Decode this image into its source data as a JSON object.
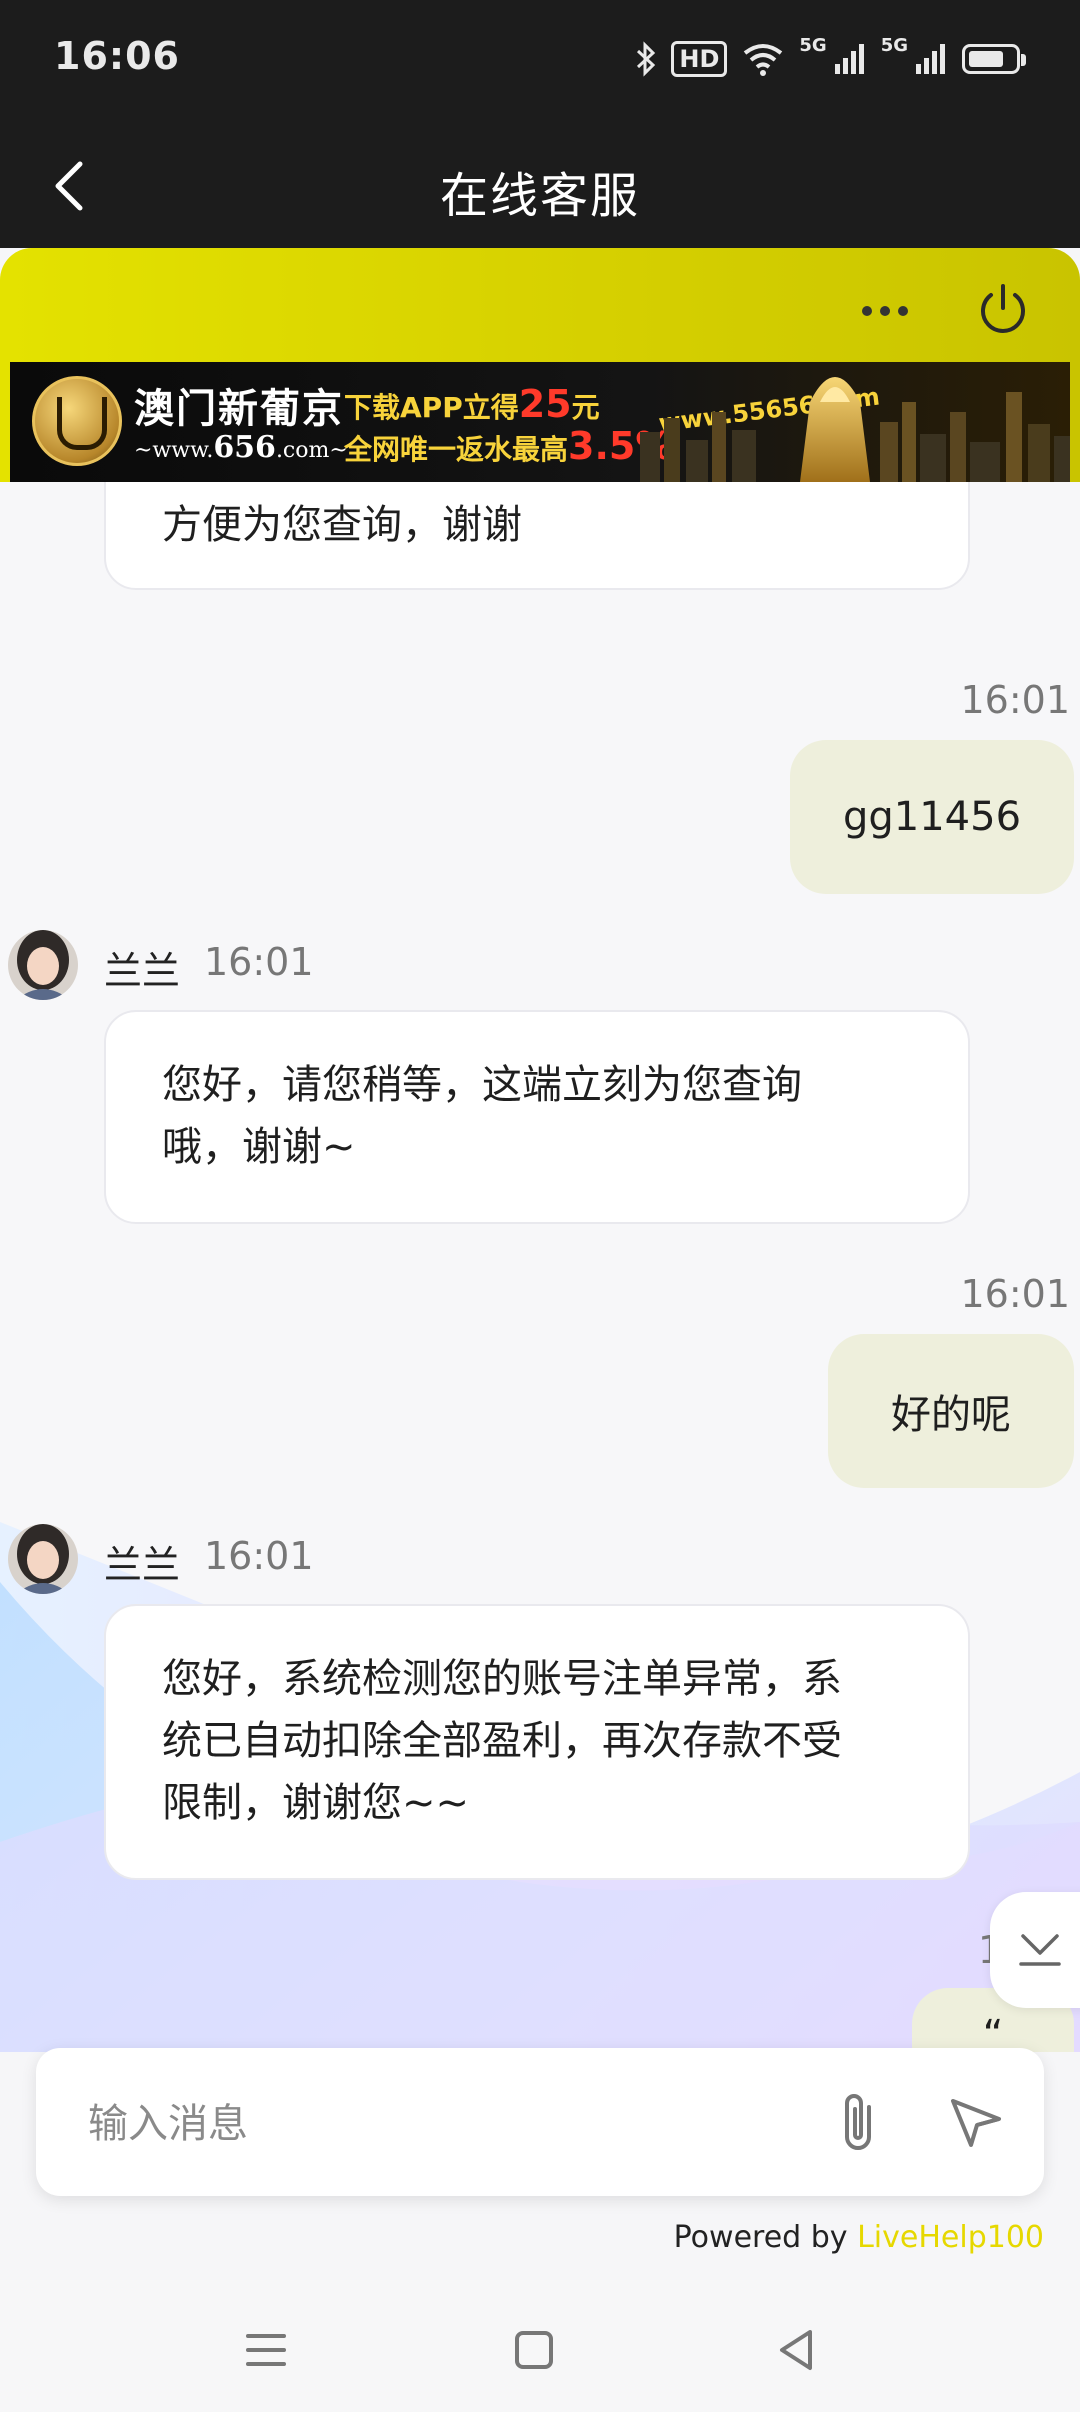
{
  "status_bar": {
    "time": "16:06",
    "hd_label": "HD",
    "network_5g_1": "5G",
    "network_5g_2": "5G"
  },
  "titlebar": {
    "title": "在线客服"
  },
  "banner": {
    "brand": "澳门新葡京",
    "domain_prefix": "~www.",
    "domain_number": "656",
    "domain_suffix": ".com~",
    "line1_text": "下载APP立得",
    "line1_amount": "25",
    "line1_unit": "元",
    "line2_text": "全网唯一返水最高",
    "line2_rate": "3.5%",
    "url": "www.55656.com"
  },
  "messages": {
    "partial_agent_text": "方便为您查询，谢谢",
    "user_msg_1": {
      "time": "16:01",
      "text": "gg11456"
    },
    "agent_msg_1": {
      "name": "兰兰",
      "time": "16:01",
      "text_line1": "您好，请您稍等，这端立刻为您查询",
      "text_line2": "哦，谢谢~"
    },
    "user_msg_2": {
      "time": "16:01",
      "text": "好的呢"
    },
    "agent_msg_2": {
      "name": "兰兰",
      "time": "16:01",
      "text_line1": "您好，系统检测您的账号注单异常，系",
      "text_line2": "统已自动扣除全部盈利，再次存款不受",
      "text_line3": "限制，谢谢您~~"
    },
    "partial_user_time": "1",
    "partial_user_text": "“"
  },
  "input": {
    "placeholder": "输入消息"
  },
  "footer": {
    "powered_by": "Powered by ",
    "brand": "LiveHelp100"
  },
  "colors": {
    "header_yellow": "#d6d000",
    "user_bubble": "#eeefdc",
    "brand_accent": "#e6d800"
  }
}
